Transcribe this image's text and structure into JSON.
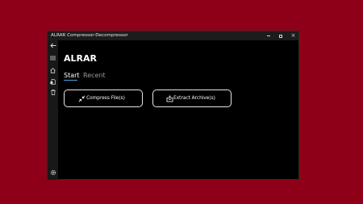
{
  "window": {
    "title": "ALRAR Compressor-Decompressor"
  },
  "controls": {
    "minimize": "minimize",
    "maximize": "maximize",
    "close": "close"
  },
  "rail": {
    "items": [
      {
        "icon": "back-arrow-icon"
      },
      {
        "icon": "hamburger-menu-icon"
      },
      {
        "icon": "home-icon"
      },
      {
        "icon": "archive-file-icon"
      },
      {
        "icon": "trash-icon"
      },
      {
        "icon": "gear-icon"
      }
    ]
  },
  "main": {
    "title": "ALRAR",
    "tabs": [
      {
        "label": "Start",
        "selected": true
      },
      {
        "label": "Recent",
        "selected": false
      }
    ],
    "actions": [
      {
        "label": "Compress File(s)",
        "icon": "compress-arrows-icon"
      },
      {
        "label": "Extract Archive(s)",
        "icon": "extract-box-icon"
      }
    ]
  },
  "colors": {
    "desktop": "#8e0018",
    "window_bg": "#000000",
    "accent": "#4aa3df",
    "tab_inactive": "#9a9a9a"
  }
}
